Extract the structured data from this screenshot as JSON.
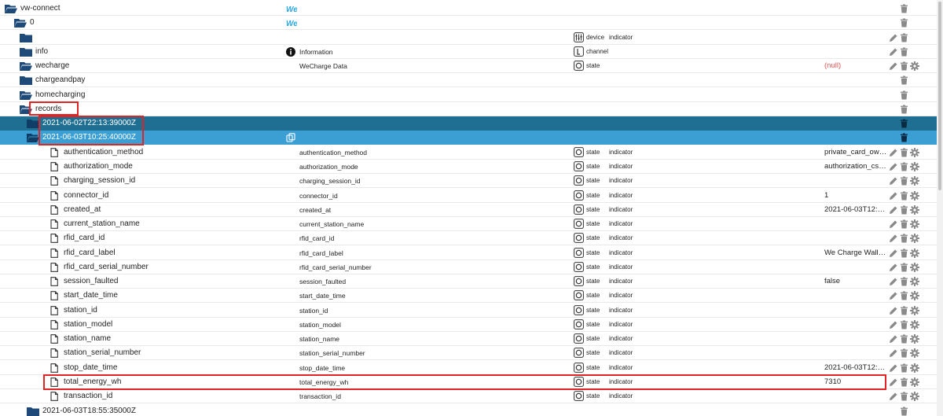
{
  "colors": {
    "folder": "#1d4a78",
    "selected_dark": "#1f6f93",
    "selected_light": "#3b9fd3",
    "highlight": "#e02424",
    "null_value": "#e05252",
    "action_icon": "#8a8a8a"
  },
  "rows": [
    {
      "kind": "folder-open",
      "indent": 0,
      "name": "vw-connect",
      "obj_icon": "we-logo",
      "obj_name": "We",
      "role_icon": "",
      "role": "",
      "srole": "",
      "value": "",
      "actions": [
        "delete"
      ]
    },
    {
      "kind": "folder-open",
      "indent": 1,
      "name": "0",
      "obj_icon": "we-logo",
      "obj_name": "We",
      "role_icon": "",
      "role": "",
      "srole": "",
      "value": "",
      "actions": [
        "delete"
      ]
    },
    {
      "kind": "folder",
      "indent": 2,
      "name": "",
      "obj_icon": "",
      "obj_name": "",
      "role_icon": "device",
      "role": "device",
      "srole": "indicator",
      "value": "",
      "actions": [
        "edit",
        "delete"
      ]
    },
    {
      "kind": "folder",
      "indent": 2,
      "name": "info",
      "obj_icon": "info",
      "obj_name": "Information",
      "role_icon": "channel",
      "role": "channel",
      "srole": "",
      "value": "",
      "actions": [
        "edit",
        "delete"
      ]
    },
    {
      "kind": "folder-open",
      "indent": 2,
      "name": "wecharge",
      "obj_icon": "",
      "obj_name": "WeCharge Data",
      "role_icon": "state",
      "role": "state",
      "srole": "",
      "value": "(null)",
      "null": true,
      "actions": [
        "edit",
        "delete",
        "gear"
      ]
    },
    {
      "kind": "folder",
      "indent": 3,
      "name": "chargeandpay",
      "obj_icon": "",
      "obj_name": "",
      "role_icon": "",
      "role": "",
      "srole": "",
      "value": "",
      "actions": [
        "delete"
      ]
    },
    {
      "kind": "folder-open",
      "indent": 3,
      "name": "homecharging",
      "obj_icon": "",
      "obj_name": "",
      "role_icon": "",
      "role": "",
      "srole": "",
      "value": "",
      "actions": [
        "delete"
      ]
    },
    {
      "kind": "folder-open",
      "indent": 4,
      "name": "records",
      "obj_icon": "",
      "obj_name": "",
      "role_icon": "",
      "role": "",
      "srole": "",
      "value": "",
      "actions": [
        "delete"
      ]
    },
    {
      "kind": "folder",
      "indent": 5,
      "name": "2021-06-02T22:13:39000Z",
      "sel": "dark",
      "obj_icon": "",
      "obj_name": "",
      "role_icon": "",
      "role": "",
      "srole": "",
      "value": "",
      "actions": [
        "delete"
      ]
    },
    {
      "kind": "folder-open",
      "indent": 5,
      "name": "2021-06-03T10:25:40000Z",
      "sel": "light",
      "obj_icon": "copy",
      "obj_name": "",
      "role_icon": "",
      "role": "",
      "srole": "",
      "value": "",
      "actions": [
        "delete"
      ]
    },
    {
      "kind": "file",
      "indent": 6,
      "name": "authentication_method",
      "obj_icon": "",
      "obj_name": "authentication_method",
      "role_icon": "state",
      "role": "state",
      "srole": "indicator",
      "value": "private_card_owned",
      "actions": [
        "edit",
        "delete",
        "gear"
      ]
    },
    {
      "kind": "file",
      "indent": 6,
      "name": "authorization_mode",
      "obj_icon": "",
      "obj_name": "authorization_mode",
      "role_icon": "state",
      "role": "state",
      "srole": "indicator",
      "value": "authorization_csms",
      "actions": [
        "edit",
        "delete",
        "gear"
      ]
    },
    {
      "kind": "file",
      "indent": 6,
      "name": "charging_session_id",
      "obj_icon": "",
      "obj_name": "charging_session_id",
      "role_icon": "state",
      "role": "state",
      "srole": "indicator",
      "value": "",
      "actions": [
        "edit",
        "delete",
        "gear"
      ]
    },
    {
      "kind": "file",
      "indent": 6,
      "name": "connector_id",
      "obj_icon": "",
      "obj_name": "connector_id",
      "role_icon": "state",
      "role": "state",
      "srole": "indicator",
      "value": "1",
      "actions": [
        "edit",
        "delete",
        "gear"
      ]
    },
    {
      "kind": "file",
      "indent": 6,
      "name": "created_at",
      "obj_icon": "",
      "obj_name": "created_at",
      "role_icon": "state",
      "role": "state",
      "srole": "indicator",
      "value": "2021-06-03T12:21…",
      "actions": [
        "edit",
        "delete",
        "gear"
      ]
    },
    {
      "kind": "file",
      "indent": 6,
      "name": "current_station_name",
      "obj_icon": "",
      "obj_name": "current_station_name",
      "role_icon": "state",
      "role": "state",
      "srole": "indicator",
      "value": "",
      "actions": [
        "edit",
        "delete",
        "gear"
      ]
    },
    {
      "kind": "file",
      "indent": 6,
      "name": "rfid_card_id",
      "obj_icon": "",
      "obj_name": "rfid_card_id",
      "role_icon": "state",
      "role": "state",
      "srole": "indicator",
      "value": "",
      "actions": [
        "edit",
        "delete",
        "gear"
      ]
    },
    {
      "kind": "file",
      "indent": 6,
      "name": "rfid_card_label",
      "obj_icon": "",
      "obj_name": "rfid_card_label",
      "role_icon": "state",
      "role": "state",
      "srole": "indicator",
      "value": "We Charge Wallb…",
      "actions": [
        "edit",
        "delete",
        "gear"
      ]
    },
    {
      "kind": "file",
      "indent": 6,
      "name": "rfid_card_serial_number",
      "obj_icon": "",
      "obj_name": "rfid_card_serial_number",
      "role_icon": "state",
      "role": "state",
      "srole": "indicator",
      "value": "",
      "actions": [
        "edit",
        "delete",
        "gear"
      ]
    },
    {
      "kind": "file",
      "indent": 6,
      "name": "session_faulted",
      "obj_icon": "",
      "obj_name": "session_faulted",
      "role_icon": "state",
      "role": "state",
      "srole": "indicator",
      "value": "false",
      "actions": [
        "edit",
        "delete",
        "gear"
      ]
    },
    {
      "kind": "file",
      "indent": 6,
      "name": "start_date_time",
      "obj_icon": "",
      "obj_name": "start_date_time",
      "role_icon": "state",
      "role": "state",
      "srole": "indicator",
      "value": "",
      "actions": [
        "edit",
        "delete",
        "gear"
      ]
    },
    {
      "kind": "file",
      "indent": 6,
      "name": "station_id",
      "obj_icon": "",
      "obj_name": "station_id",
      "role_icon": "state",
      "role": "state",
      "srole": "indicator",
      "value": "",
      "actions": [
        "edit",
        "delete",
        "gear"
      ]
    },
    {
      "kind": "file",
      "indent": 6,
      "name": "station_model",
      "obj_icon": "",
      "obj_name": "station_model",
      "role_icon": "state",
      "role": "state",
      "srole": "indicator",
      "value": "",
      "actions": [
        "edit",
        "delete",
        "gear"
      ]
    },
    {
      "kind": "file",
      "indent": 6,
      "name": "station_name",
      "obj_icon": "",
      "obj_name": "station_name",
      "role_icon": "state",
      "role": "state",
      "srole": "indicator",
      "value": "",
      "actions": [
        "edit",
        "delete",
        "gear"
      ]
    },
    {
      "kind": "file",
      "indent": 6,
      "name": "station_serial_number",
      "obj_icon": "",
      "obj_name": "station_serial_number",
      "role_icon": "state",
      "role": "state",
      "srole": "indicator",
      "value": "",
      "actions": [
        "edit",
        "delete",
        "gear"
      ]
    },
    {
      "kind": "file",
      "indent": 6,
      "name": "stop_date_time",
      "obj_icon": "",
      "obj_name": "stop_date_time",
      "role_icon": "state",
      "role": "state",
      "srole": "indicator",
      "value": "2021-06-03T12:21…",
      "actions": [
        "edit",
        "delete",
        "gear"
      ]
    },
    {
      "kind": "file",
      "indent": 6,
      "name": "total_energy_wh",
      "obj_icon": "",
      "obj_name": "total_energy_wh",
      "role_icon": "state",
      "role": "state",
      "srole": "indicator",
      "value": "7310",
      "actions": [
        "edit",
        "delete",
        "gear"
      ]
    },
    {
      "kind": "file",
      "indent": 6,
      "name": "transaction_id",
      "obj_icon": "",
      "obj_name": "transaction_id",
      "role_icon": "state",
      "role": "state",
      "srole": "indicator",
      "value": "",
      "actions": [
        "edit",
        "delete",
        "gear"
      ]
    },
    {
      "kind": "folder",
      "indent": 5,
      "name": "2021-06-03T18:55:35000Z",
      "obj_icon": "",
      "obj_name": "",
      "role_icon": "",
      "role": "",
      "srole": "",
      "value": "",
      "actions": [
        "delete"
      ]
    }
  ]
}
